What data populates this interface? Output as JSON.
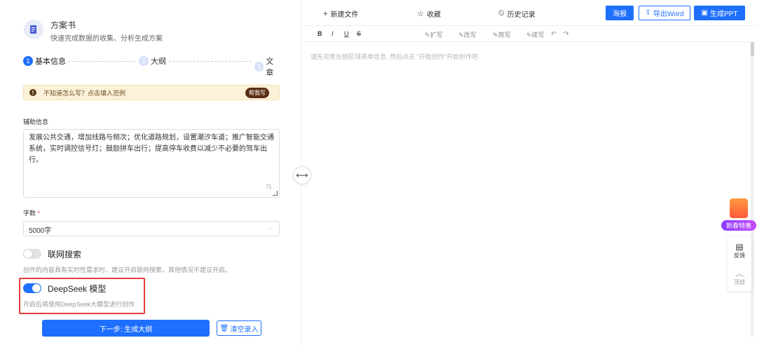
{
  "app": {
    "title": "方案书",
    "subtitle": "快速完成数据的收集、分析生成方案"
  },
  "steps": [
    {
      "num": "1",
      "label": "基本信息"
    },
    {
      "num": "2",
      "label": "大纲"
    },
    {
      "num": "3",
      "label": "文章"
    }
  ],
  "tip": {
    "icon": "!",
    "text": "不知道怎么写？点击填入范例",
    "button": "帮我写"
  },
  "aux": {
    "label": "辅助信息",
    "value": "发展公共交通，增加线路与频次；优化道路规划，设置潮汐车道；推广智能交通系统，实时调控信号灯；鼓励拼车出行；提高停车收费以减少不必要的驾车出行。",
    "count": "71"
  },
  "wordcount": {
    "label": "字数",
    "required_mark": "*",
    "value": "5000字"
  },
  "web_search": {
    "label": "联网搜索",
    "on": false,
    "hint": "创作的内容具有实时性需求时，建议开启联网搜索，其他情况不建议开启。"
  },
  "deepseek": {
    "label": "DeepSeek 模型",
    "on": true,
    "hint": "开启后将使用DeepSeek大模型进行创作"
  },
  "actions": {
    "next": "下一步: 生成大纲",
    "clear": "清空录入"
  },
  "topbar": {
    "new_file": "新建文件",
    "favorite": "收藏",
    "history": "历史记录",
    "poster": "海报",
    "export_word": "导出Word",
    "gen_ppt": "生成PPT"
  },
  "format": {
    "bold": "B",
    "italic": "I",
    "underline": "U",
    "strike": "S",
    "expand": "扩写",
    "rewrite": "改写",
    "shorten": "简写",
    "continue": "续写"
  },
  "editor": {
    "placeholder": "请先完善左侧区域表单信息, 然后点击 \"开始创作\"开始创作吧"
  },
  "promo": {
    "label": "新春特惠"
  },
  "sidetools": {
    "feedback": "反馈",
    "top": "顶部"
  },
  "colors": {
    "accent": "#1f6fff",
    "highlight_border": "#e43b3b",
    "tip_bg": "#fcf1d9"
  }
}
